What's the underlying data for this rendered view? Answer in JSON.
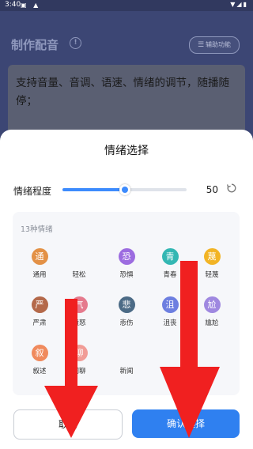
{
  "status_bar": {
    "time": "3:40",
    "left_icons": "▣ ▲",
    "right_icons": "▼◢▮"
  },
  "background_screen": {
    "title": "制作配音",
    "info_icon": "info-icon",
    "assist_button": "辅助功能",
    "editor_text": "支持音量、音调、语速、情绪的调节，随播随停；"
  },
  "sheet": {
    "title": "情绪选择",
    "degree": {
      "label": "情绪程度",
      "value": "50",
      "level": 0.5
    },
    "emotion_count": "13种情绪",
    "emotions": [
      {
        "glyph": "通",
        "label": "通用",
        "color": "#e39146"
      },
      {
        "glyph": "",
        "label": "轻松",
        "color": "#f6f7fa"
      },
      {
        "glyph": "恐",
        "label": "恐惧",
        "color": "#9c6ce0"
      },
      {
        "glyph": "青",
        "label": "青春",
        "color": "#33b7b3"
      },
      {
        "glyph": "蔑",
        "label": "轻蔑",
        "color": "#f2b425"
      },
      {
        "glyph": "严",
        "label": "严肃",
        "color": "#b4694a"
      },
      {
        "glyph": "气",
        "label": "愤怒",
        "color": "#e57a8d"
      },
      {
        "glyph": "悲",
        "label": "悲伤",
        "color": "#4c6b86"
      },
      {
        "glyph": "沮",
        "label": "沮丧",
        "color": "#6d7fe0"
      },
      {
        "glyph": "尬",
        "label": "尴尬",
        "color": "#9f88e0"
      },
      {
        "glyph": "叙",
        "label": "叙述",
        "color": "#f08a5d"
      },
      {
        "glyph": "聊",
        "label": "闲聊",
        "color": "#f19c96"
      },
      {
        "glyph": "",
        "label": "新闻",
        "color": "#f6f7fa"
      }
    ],
    "cancel_button": "取消",
    "confirm_button": "确认选择"
  },
  "colors": {
    "accent": "#2f80f0",
    "annotation_arrow": "#f02020"
  }
}
